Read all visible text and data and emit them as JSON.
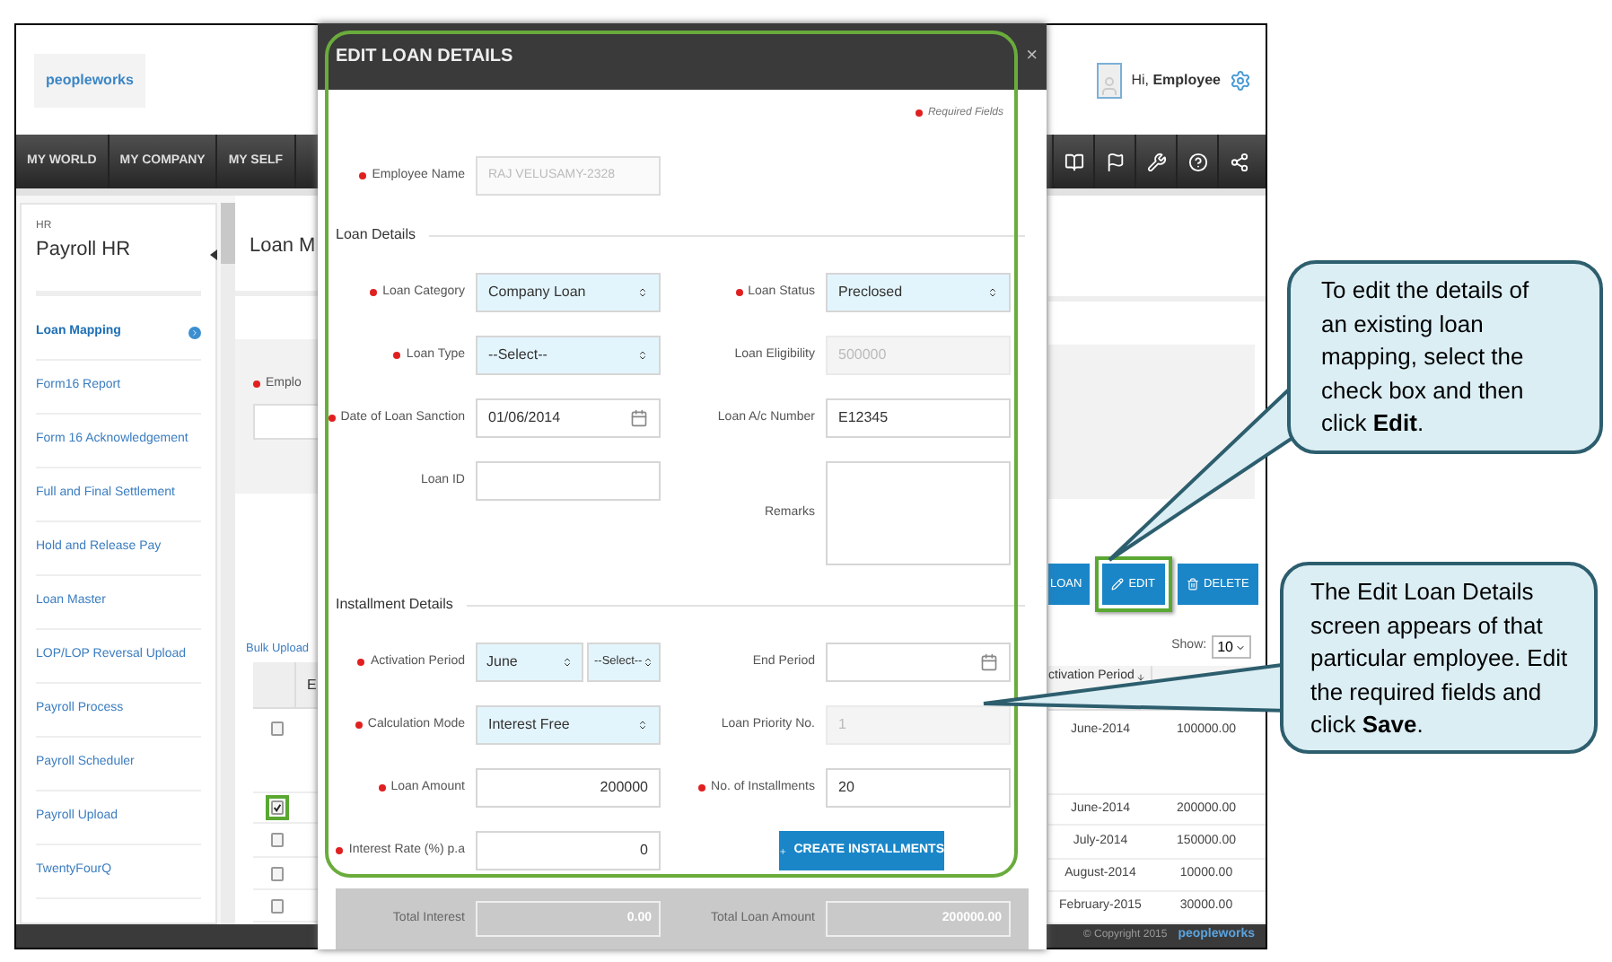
{
  "header": {
    "logo": "peopleworks",
    "greeting": "Hi, **Employee**"
  },
  "nav": {
    "tabs": [
      "MY WORLD",
      "MY COMPANY",
      "MY SELF"
    ]
  },
  "sidebar": {
    "section": "HR",
    "title": "Payroll HR",
    "items": [
      {
        "label": "Loan Mapping",
        "selected": true
      },
      {
        "label": "Form16 Report",
        "selected": false
      },
      {
        "label": "Form 16 Acknowledgement",
        "selected": false
      },
      {
        "label": "Full and Final Settlement",
        "selected": false
      },
      {
        "label": "Hold and Release Pay",
        "selected": false
      },
      {
        "label": "Loan Master",
        "selected": false
      },
      {
        "label": "LOP/LOP Reversal Upload",
        "selected": false
      },
      {
        "label": "Payroll Process",
        "selected": false
      },
      {
        "label": "Payroll Scheduler",
        "selected": false
      },
      {
        "label": "Payroll Upload",
        "selected": false
      },
      {
        "label": "TwentyFourQ",
        "selected": false
      }
    ]
  },
  "page": {
    "title": "Loan M",
    "filter_label": "Emplo",
    "bulk_upload": "Bulk Upload",
    "buttons": [
      {
        "kind": "add",
        "label": "LOAN",
        "highlighted": false
      },
      {
        "kind": "edit",
        "label": "EDIT",
        "highlighted": true
      },
      {
        "kind": "delete",
        "label": "DELETE",
        "highlighted": false
      }
    ],
    "show_label": "Show:",
    "show_value": "10"
  },
  "table": {
    "columns": [
      "E",
      "ctivation Period"
    ],
    "rows": [
      {
        "checked": false,
        "highlighted": false,
        "activation": "June-2014",
        "amount": "100000.00"
      },
      {
        "checked": true,
        "highlighted": true,
        "activation": "June-2014",
        "amount": "200000.00"
      },
      {
        "checked": false,
        "highlighted": false,
        "activation": "July-2014",
        "amount": "150000.00"
      },
      {
        "checked": false,
        "highlighted": false,
        "activation": "August-2014",
        "amount": "10000.00"
      },
      {
        "checked": false,
        "highlighted": false,
        "activation": "February-2015",
        "amount": "30000.00"
      }
    ]
  },
  "footer": {
    "copyright": "© Copyright 2015",
    "logo": "peopleworks"
  },
  "modal": {
    "title": "EDIT LOAN DETAILS",
    "close": "×",
    "highlighted": true,
    "required_note": "Required Fields",
    "employee": {
      "label": "Employee Name",
      "value": "RAJ VELUSAMY-2328",
      "required": true,
      "disabled": true
    },
    "sections": [
      {
        "title": "Loan Details",
        "rows": [
          [
            {
              "kind": "select",
              "label": "Loan Category",
              "value": "Company Loan",
              "required": true,
              "disabled": false
            },
            {
              "kind": "select",
              "label": "Loan Status",
              "value": "Preclosed",
              "required": true,
              "disabled": false
            }
          ],
          [
            {
              "kind": "select",
              "label": "Loan Type",
              "value": "--Select--",
              "required": true,
              "disabled": false
            },
            {
              "kind": "text",
              "label": "Loan Eligibility",
              "value": "500000",
              "required": false,
              "disabled": true
            }
          ],
          [
            {
              "kind": "date",
              "label": "Date of Loan Sanction",
              "value": "01/06/2014",
              "required": true,
              "disabled": false
            },
            {
              "kind": "text",
              "label": "Loan A/c Number",
              "value": "E12345",
              "required": false,
              "disabled": false
            }
          ],
          [
            {
              "kind": "text",
              "label": "Loan ID",
              "required": false,
              "disabled": false
            },
            {
              "kind": "textarea",
              "label": "Remarks",
              "required": false,
              "disabled": false
            }
          ]
        ]
      },
      {
        "title": "Installment Details",
        "rows": [
          [
            {
              "kind": "double_select",
              "label": "Activation Period",
              "values": [
                "June",
                "--Select--"
              ],
              "required": true,
              "disabled": false
            },
            {
              "kind": "date",
              "label": "End Period",
              "required": false,
              "disabled": false
            }
          ],
          [
            {
              "kind": "select",
              "label": "Calculation Mode",
              "value": "Interest Free",
              "required": true,
              "disabled": false
            },
            {
              "kind": "text",
              "label": "Loan Priority No.",
              "value": "1",
              "required": false,
              "disabled": true
            }
          ],
          [
            {
              "kind": "amount",
              "label": "Loan Amount",
              "value": "200000",
              "required": true,
              "disabled": false
            },
            {
              "kind": "text",
              "label": "No. of Installments",
              "value": "20",
              "required": true,
              "disabled": false
            }
          ],
          [
            {
              "kind": "amount",
              "label": "Interest Rate (%) p.a",
              "value": "0",
              "required": true,
              "disabled": false
            },
            {
              "kind": "button",
              "label": "CREATE INSTALLMENTS"
            }
          ]
        ]
      }
    ],
    "totals": [
      {
        "label": "Total Interest",
        "value": "0.00"
      },
      {
        "label": "Total Loan Amount",
        "value": "200000.00"
      }
    ]
  },
  "callouts": [
    {
      "text": "To edit the details of an existing loan mapping, select the check box and then click **Edit**."
    },
    {
      "text": "The Edit Loan Details screen appears of that particular employee. Edit the required fields and click **Save**."
    }
  ]
}
